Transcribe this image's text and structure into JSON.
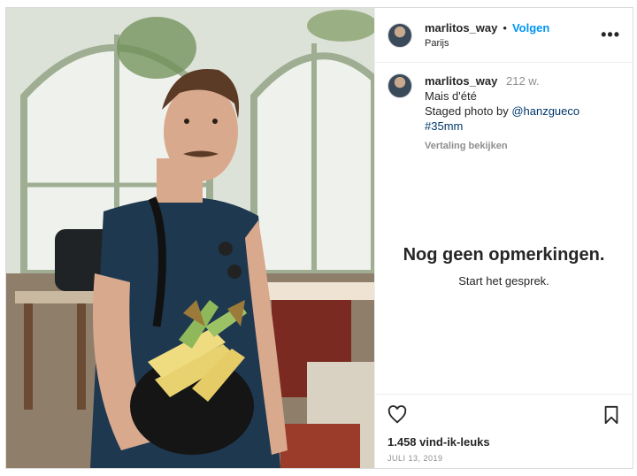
{
  "post": {
    "username": "marlitos_way",
    "follow_label": "Volgen",
    "location": "Parijs",
    "more_label": "•••"
  },
  "caption": {
    "username": "marlitos_way",
    "time": "212 w.",
    "line1": "Mais d'été",
    "line2_prefix": "Staged photo by ",
    "mention": "@hanzgueco",
    "hashtag": "#35mm",
    "translate": "Vertaling bekijken"
  },
  "comments": {
    "empty_title": "Nog geen opmerkingen.",
    "empty_sub": "Start het gesprek."
  },
  "footer": {
    "likes": "1.458 vind-ik-leuks",
    "date": "JULI 13, 2019"
  },
  "icons": {
    "like": "heart-icon",
    "save": "bookmark-icon",
    "more": "more-icon"
  },
  "colors": {
    "accent": "#0095f6",
    "link": "#00376b",
    "muted": "#8e8e8e"
  }
}
